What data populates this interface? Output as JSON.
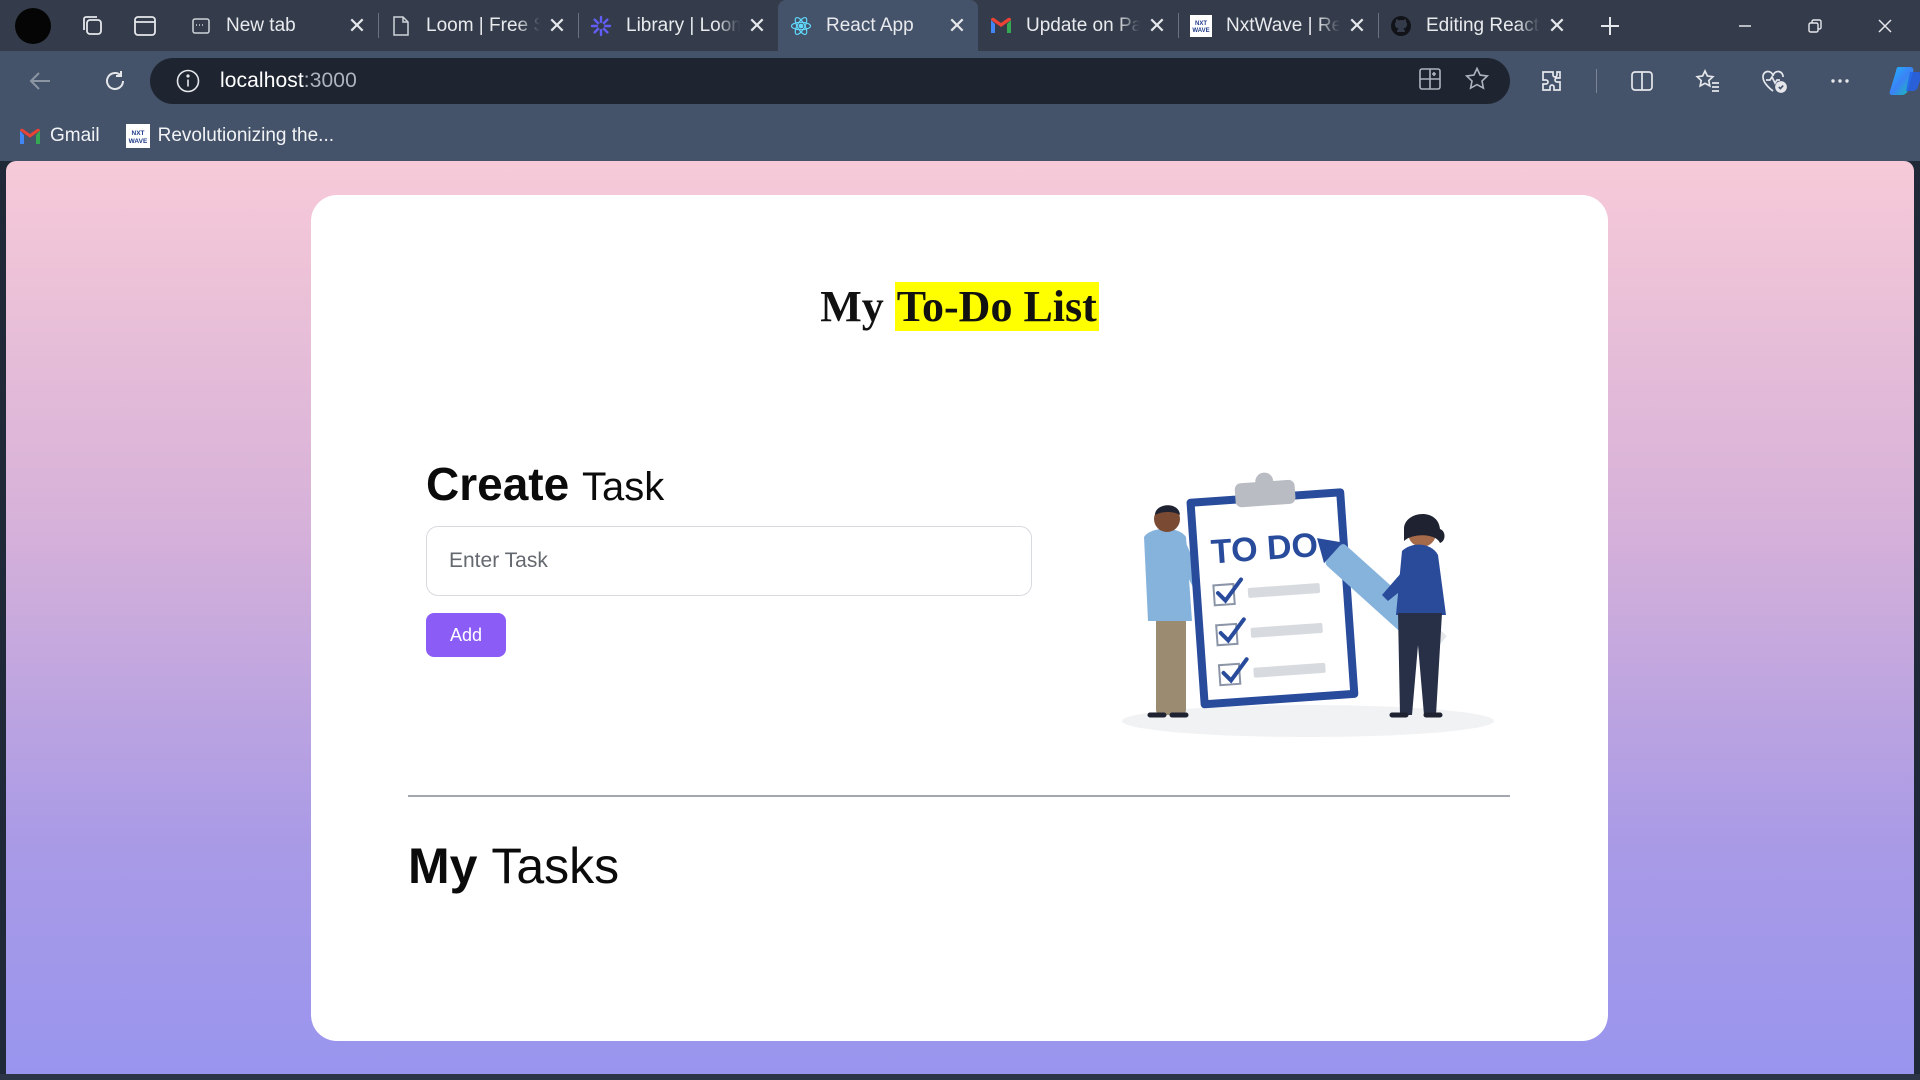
{
  "browser": {
    "tabs": [
      {
        "title": "New tab",
        "favicon": "newtab-icon",
        "active": false
      },
      {
        "title": "Loom | Free Screen",
        "favicon": "page-icon",
        "active": false
      },
      {
        "title": "Library | Loom",
        "favicon": "loom-icon",
        "active": false
      },
      {
        "title": "React App",
        "favicon": "react-icon",
        "active": true
      },
      {
        "title": "Update on Pa",
        "favicon": "gmail-icon",
        "active": false
      },
      {
        "title": "NxtWave | Re",
        "favicon": "nxtwave-icon",
        "active": false
      },
      {
        "title": "Editing React",
        "favicon": "github-icon",
        "active": false
      }
    ],
    "url_host": "localhost",
    "url_port": ":3000",
    "bookmarks": [
      {
        "label": "Gmail",
        "icon": "gmail-icon"
      },
      {
        "label": "Revolutionizing the...",
        "icon": "nxtwave-icon"
      }
    ]
  },
  "app": {
    "heading_prefix": "My",
    "heading_highlight": "To-Do List",
    "create_bold": "Create",
    "create_light": "Task",
    "input_placeholder": "Enter Task",
    "add_label": "Add",
    "illustration_text": "TO DO",
    "tasks_bold": "My",
    "tasks_light": "Tasks"
  },
  "colors": {
    "accent_button": "#8b5cf6",
    "highlight": "#ffff00",
    "tab_bar": "#343c4b",
    "toolbar": "#44526a"
  }
}
